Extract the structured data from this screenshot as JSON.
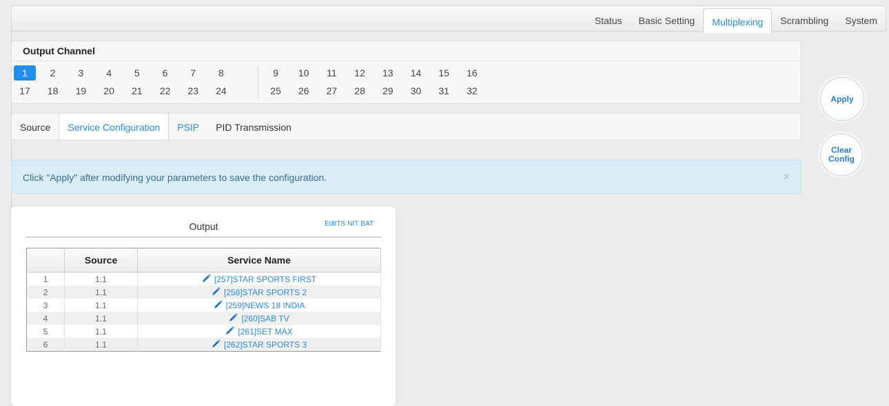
{
  "nav": {
    "tabs": [
      {
        "label": "Status",
        "active": false
      },
      {
        "label": "Basic Setting",
        "active": false
      },
      {
        "label": "Multiplexing",
        "active": true
      },
      {
        "label": "Scrambling",
        "active": false
      },
      {
        "label": "System",
        "active": false
      }
    ]
  },
  "output_channel": {
    "title": "Output Channel",
    "selected": "1",
    "row1": [
      "1",
      "2",
      "3",
      "4",
      "5",
      "6",
      "7",
      "8",
      "9",
      "10",
      "11",
      "12",
      "13",
      "14",
      "15",
      "16"
    ],
    "row2": [
      "17",
      "18",
      "19",
      "20",
      "21",
      "22",
      "23",
      "24",
      "25",
      "26",
      "27",
      "28",
      "29",
      "30",
      "31",
      "32"
    ]
  },
  "sub_tabs": [
    {
      "label": "Source"
    },
    {
      "label": "Service Configuration"
    },
    {
      "label": "PSIP"
    },
    {
      "label": "PID Transmission"
    }
  ],
  "alert": {
    "message": "Click \"Apply\" after modifying your parameters to save the configuration.",
    "close": "×"
  },
  "buttons": {
    "apply": "Apply",
    "clear_config": "Clear Config"
  },
  "output": {
    "title": "Output",
    "links": [
      "EditTS",
      "NIT",
      "BAT"
    ],
    "columns": [
      "",
      "Source",
      "Service Name"
    ],
    "rows": [
      {
        "index": "1",
        "source": "1.1",
        "service": "[257]STAR SPORTS FIRST"
      },
      {
        "index": "2",
        "source": "1.1",
        "service": "[258]STAR SPORTS 2"
      },
      {
        "index": "3",
        "source": "1.1",
        "service": "[259]NEWS 18 INDIA"
      },
      {
        "index": "4",
        "source": "1.1",
        "service": "[260]SAB TV"
      },
      {
        "index": "5",
        "source": "1.1",
        "service": "[261]SET MAX"
      },
      {
        "index": "6",
        "source": "1.1",
        "service": "[262]STAR SPORTS 3"
      }
    ]
  },
  "colors": {
    "accent": "#2a8be0",
    "alert_bg": "#d9edf7"
  }
}
